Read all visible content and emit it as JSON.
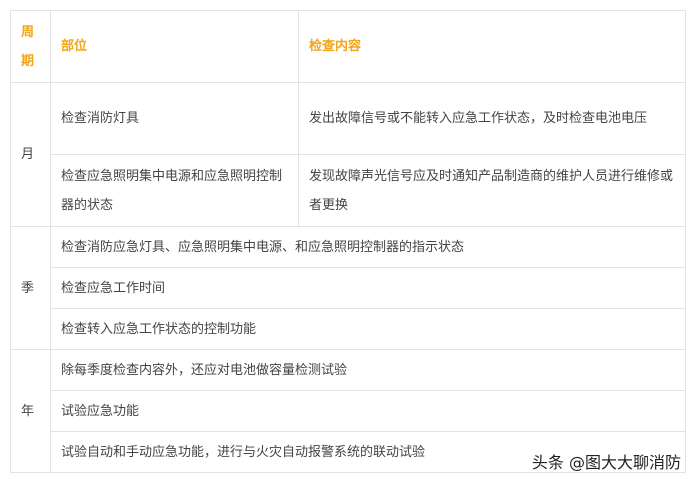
{
  "header": {
    "period": "周期",
    "location": "部位",
    "content": "检查内容"
  },
  "groups": {
    "month": {
      "label": "月",
      "rows": [
        {
          "location": "检查消防灯具",
          "content": "发出故障信号或不能转入应急工作状态，及时检查电池电压"
        },
        {
          "location": "检查应急照明集中电源和应急照明控制器的状态",
          "content": "发现故障声光信号应及时通知产品制造商的维护人员进行维修或者更换"
        }
      ]
    },
    "season": {
      "label": "季",
      "rows": [
        "检查消防应急灯具、应急照明集中电源、和应急照明控制器的指示状态",
        "检查应急工作时间",
        "检查转入应急工作状态的控制功能"
      ]
    },
    "year": {
      "label": "年",
      "rows": [
        "除每季度检查内容外，还应对电池做容量检测试验",
        "试验应急功能",
        "试验自动和手动应急功能，进行与火灾自动报警系统的联动试验"
      ]
    }
  },
  "watermark": "头条 @图大大聊消防"
}
